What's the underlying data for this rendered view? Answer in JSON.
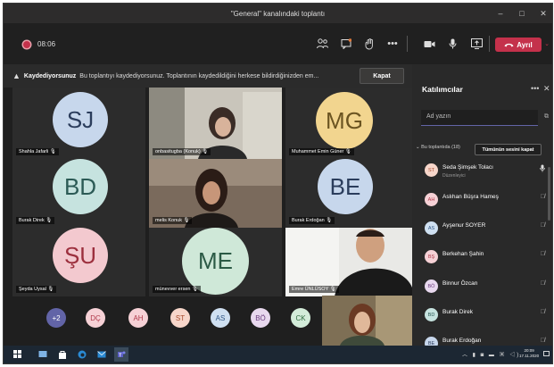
{
  "window": {
    "title": "\"General\" kanalındaki toplantı",
    "min": "–",
    "max": "□",
    "close": "✕"
  },
  "toolbar": {
    "timer": "08:06",
    "leave_label": "Ayrıl",
    "more": "•••"
  },
  "banner": {
    "title": "Kaydediyorsunuz",
    "text": "Bu toplantıyı kaydediyorsunuz. Toplantının kaydedildiğini herkese bildirdiğinizden em...",
    "dismiss": "Kapat"
  },
  "tiles": [
    {
      "initials": "SJ",
      "name": "Shahla Jafarli"
    },
    {
      "name": "onbasitugba (Konuk)"
    },
    {
      "initials": "MG",
      "name": "Muhammet Emin Güner"
    },
    {
      "initials": "BD",
      "name": "Burak Direk"
    },
    {
      "name": "melis Konuk"
    },
    {
      "initials": "BE",
      "name": "Burak Erdoğan"
    },
    {
      "initials": "ŞU",
      "name": "Şeyda Uysal"
    },
    {
      "initials": "ME",
      "name": "münevver ersen"
    },
    {
      "name": "Emre ÜNLÜSOY"
    }
  ],
  "overflow": {
    "more": "+2",
    "chips": [
      "DÇ",
      "AH",
      "ST",
      "AS",
      "BÖ",
      "CK"
    ]
  },
  "panel": {
    "title": "Katılımcılar",
    "search_placeholder": "Ad yazın",
    "section": "Bu toplantıda (18)",
    "mute_all": "Tümünün sesini kapat",
    "people": [
      {
        "initials": "ST",
        "name": "Seda Şimşek Tolacı",
        "role": "Düzenleyici"
      },
      {
        "initials": "AH",
        "name": "Aslıhan Büşra Hameş"
      },
      {
        "initials": "AS",
        "name": "Ayşenur SOYER"
      },
      {
        "initials": "BŞ",
        "name": "Berkehan Şahin"
      },
      {
        "initials": "BÖ",
        "name": "Binnur Özcan"
      },
      {
        "initials": "BD",
        "name": "Burak Direk"
      },
      {
        "initials": "BE",
        "name": "Burak Erdoğan"
      }
    ]
  },
  "taskbar": {
    "time": "20:09",
    "date": "17.11.2020"
  }
}
